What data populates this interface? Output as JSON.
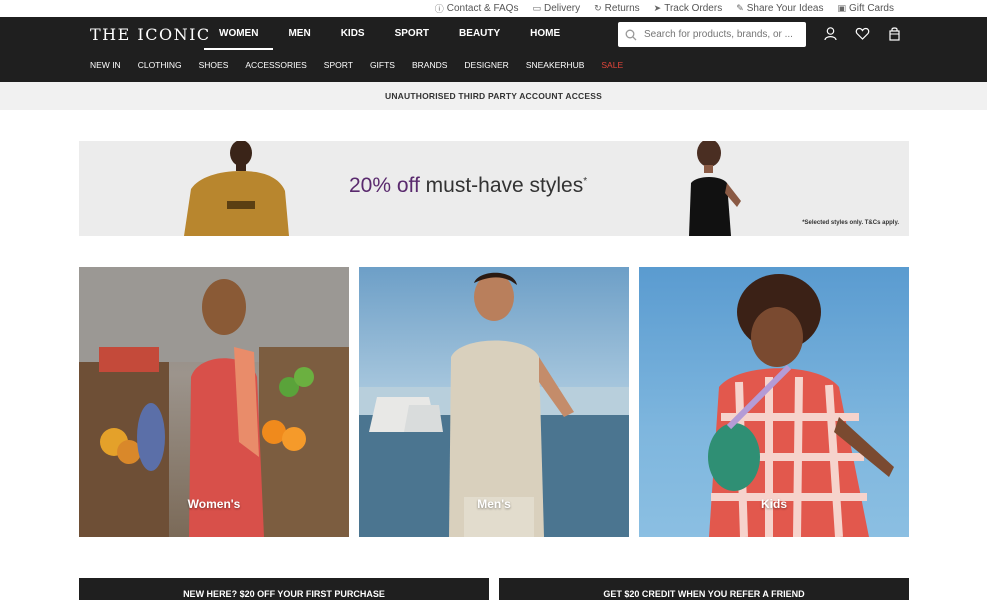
{
  "utility_bar": {
    "items": [
      {
        "label": "Contact & FAQs",
        "icon": "info-icon"
      },
      {
        "label": "Delivery",
        "icon": "truck-icon"
      },
      {
        "label": "Returns",
        "icon": "returns-icon"
      },
      {
        "label": "Track Orders",
        "icon": "send-icon"
      },
      {
        "label": "Share Your Ideas",
        "icon": "ideas-icon"
      },
      {
        "label": "Gift Cards",
        "icon": "gift-card-icon"
      }
    ]
  },
  "header": {
    "logo": "THE ICONIC",
    "main_nav": [
      {
        "label": "WOMEN",
        "active": true
      },
      {
        "label": "MEN",
        "active": false
      },
      {
        "label": "KIDS",
        "active": false
      },
      {
        "label": "SPORT",
        "active": false
      },
      {
        "label": "BEAUTY",
        "active": false
      },
      {
        "label": "HOME",
        "active": false
      }
    ],
    "search": {
      "placeholder": "Search for products, brands, or ..."
    },
    "icons": [
      "account-icon",
      "wishlist-icon",
      "bag-icon"
    ],
    "sub_nav": [
      "NEW IN",
      "CLOTHING",
      "SHOES",
      "ACCESSORIES",
      "SPORT",
      "GIFTS",
      "BRANDS",
      "DESIGNER",
      "SNEAKERHUB",
      "SALE"
    ],
    "colors": {
      "background": "#1f1f1f",
      "sale": "#e0453a"
    }
  },
  "alert": {
    "text": "UNAUTHORISED THIRD PARTY ACCOUNT ACCESS"
  },
  "promo_banner": {
    "accent_text": "20% off",
    "text": " must-have styles",
    "superscript": "*",
    "fine_print": "*Selected styles only. T&Cs apply.",
    "accent_color": "#5a2a6e"
  },
  "categories": [
    {
      "label": "Women's"
    },
    {
      "label": "Men's"
    },
    {
      "label": "Kids"
    }
  ],
  "bottom_bars": [
    {
      "text": "NEW HERE? $20 OFF YOUR FIRST PURCHASE"
    },
    {
      "text": "GET $20 CREDIT WHEN YOU REFER A FRIEND"
    }
  ]
}
